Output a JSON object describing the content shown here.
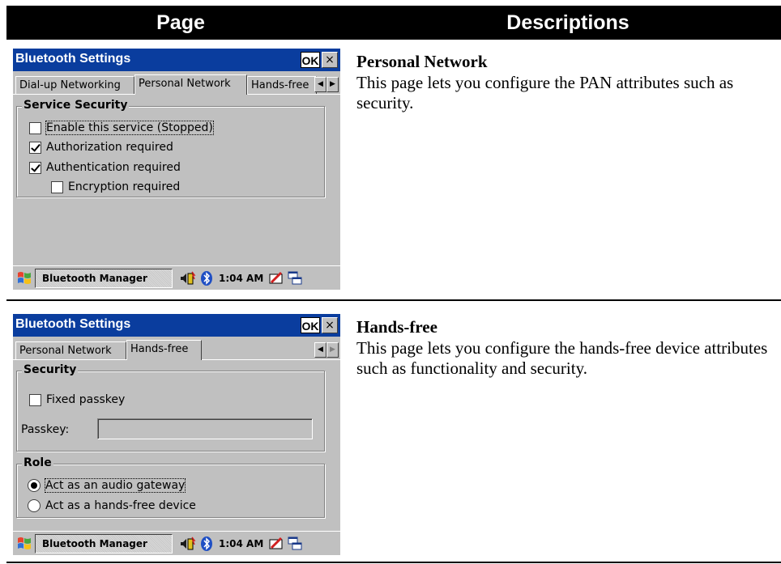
{
  "header": {
    "page": "Page",
    "descriptions": "Descriptions"
  },
  "rows": [
    {
      "title": "Personal Network",
      "description": "This page lets you configure the PAN attributes such as security.",
      "screen": {
        "title": "Bluetooth Settings",
        "ok": "OK",
        "close": "×",
        "tabs": [
          "Dial-up Networking",
          "Personal Network",
          "Hands-free"
        ],
        "active_tab": "Personal Network",
        "group": "Service Security",
        "options": [
          {
            "label": "Enable this service (Stopped)",
            "checked": false
          },
          {
            "label": "Authorization required",
            "checked": true
          },
          {
            "label": "Authentication required",
            "checked": true
          },
          {
            "label": "Encryption required",
            "checked": false
          }
        ],
        "taskbar_app": "Bluetooth Manager",
        "clock": "1:04 AM"
      }
    },
    {
      "title": "Hands-free",
      "description": "This page lets you configure the hands-free device attributes such as functionality and security.",
      "screen": {
        "title": "Bluetooth Settings",
        "ok": "OK",
        "close": "×",
        "tabs": [
          "Personal Network",
          "Hands-free"
        ],
        "active_tab": "Hands-free",
        "security_group": "Security",
        "fixed_passkey": {
          "label": "Fixed passkey",
          "checked": false
        },
        "passkey_label": "Passkey:",
        "passkey_value": "",
        "role_group": "Role",
        "roles": [
          {
            "label": "Act as an audio gateway",
            "selected": true
          },
          {
            "label": "Act as a hands-free device",
            "selected": false
          }
        ],
        "taskbar_app": "Bluetooth Manager",
        "clock": "1:04 AM"
      }
    }
  ]
}
